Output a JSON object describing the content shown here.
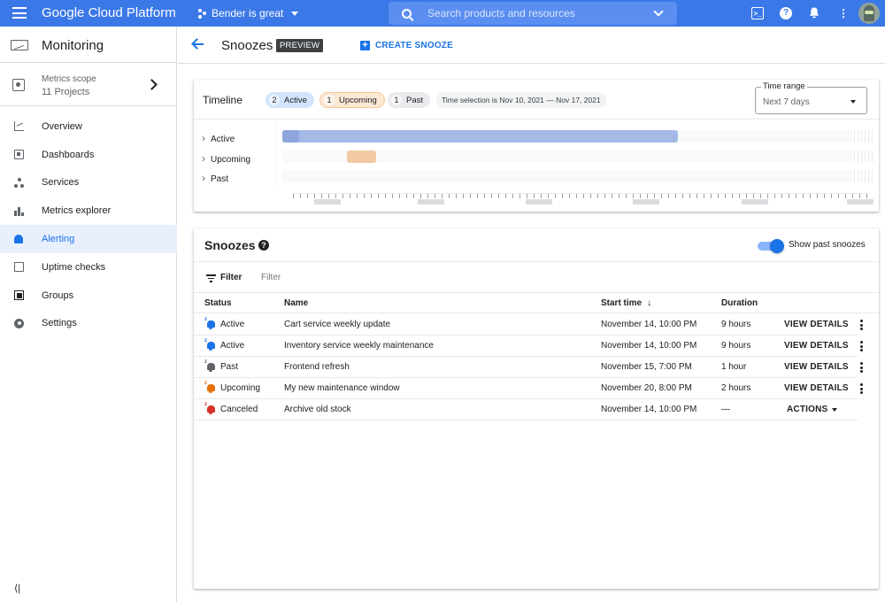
{
  "topbar": {
    "brand": "Google Cloud Platform",
    "project": "Bender is great",
    "search_placeholder": "Search products and resources",
    "icons": [
      "menu-icon",
      "project-icon",
      "search-icon",
      "terminal-icon",
      "help-icon",
      "notifications-icon",
      "more-vert-icon",
      "avatar"
    ]
  },
  "sidebar": {
    "title": "Monitoring",
    "scope": {
      "label": "Metrics scope",
      "value": "11 Projects"
    },
    "items": [
      {
        "label": "Overview",
        "icon": "overview-icon"
      },
      {
        "label": "Dashboards",
        "icon": "dashboards-icon"
      },
      {
        "label": "Services",
        "icon": "services-icon"
      },
      {
        "label": "Metrics explorer",
        "icon": "bar-chart-icon"
      },
      {
        "label": "Alerting",
        "icon": "bell-icon",
        "active": true
      },
      {
        "label": "Uptime checks",
        "icon": "uptime-icon"
      },
      {
        "label": "Groups",
        "icon": "groups-icon"
      },
      {
        "label": "Settings",
        "icon": "gear-icon"
      }
    ],
    "collapse": "⟨|"
  },
  "header": {
    "title": "Snoozes",
    "badge": "PREVIEW",
    "create_label": "CREATE SNOOZE"
  },
  "timeline": {
    "title": "Timeline",
    "chips": {
      "active": {
        "count": "2",
        "label": "Active"
      },
      "upcoming": {
        "count": "1",
        "label": "Upcoming"
      },
      "past": {
        "count": "1",
        "label": "Past"
      }
    },
    "time_selection": "Time selection is Nov 10, 2021 — Nov 17, 2021",
    "time_range": {
      "label": "Time range",
      "value": "Next 7 days"
    },
    "rows": [
      "Active",
      "Upcoming",
      "Past"
    ],
    "colors": {
      "active": "#a5b9e6",
      "upcoming": "#f1c9a5"
    }
  },
  "snoozes": {
    "title": "Snoozes",
    "toggle_label": "Show past snoozes",
    "toggle_on": true,
    "filter_label": "Filter",
    "filter_placeholder": "Filter",
    "columns": {
      "status": "Status",
      "name": "Name",
      "start": "Start time",
      "duration": "Duration"
    },
    "rows": [
      {
        "status": "Active",
        "name": "Cart service weekly update",
        "start": "November 14, 10:00 PM",
        "duration": "9 hours",
        "action": "VIEW DETAILS",
        "color": "#1a73e8"
      },
      {
        "status": "Active",
        "name": "Inventory service weekly maintenance",
        "start": "November 14, 10:00 PM",
        "duration": "9 hours",
        "action": "VIEW DETAILS",
        "color": "#1a73e8"
      },
      {
        "status": "Past",
        "name": "Frontend refresh",
        "start": "November 15, 7:00 PM",
        "duration": "1 hour",
        "action": "VIEW DETAILS",
        "color": "#5f6368"
      },
      {
        "status": "Upcoming",
        "name": "My new maintenance window",
        "start": "November 20, 8:00 PM",
        "duration": "2 hours",
        "action": "VIEW DETAILS",
        "color": "#e8710a"
      },
      {
        "status": "Canceled",
        "name": "Archive old stock",
        "start": "November 14, 10:00 PM",
        "duration": "—",
        "action": "ACTIONS",
        "color": "#d93025"
      }
    ]
  }
}
